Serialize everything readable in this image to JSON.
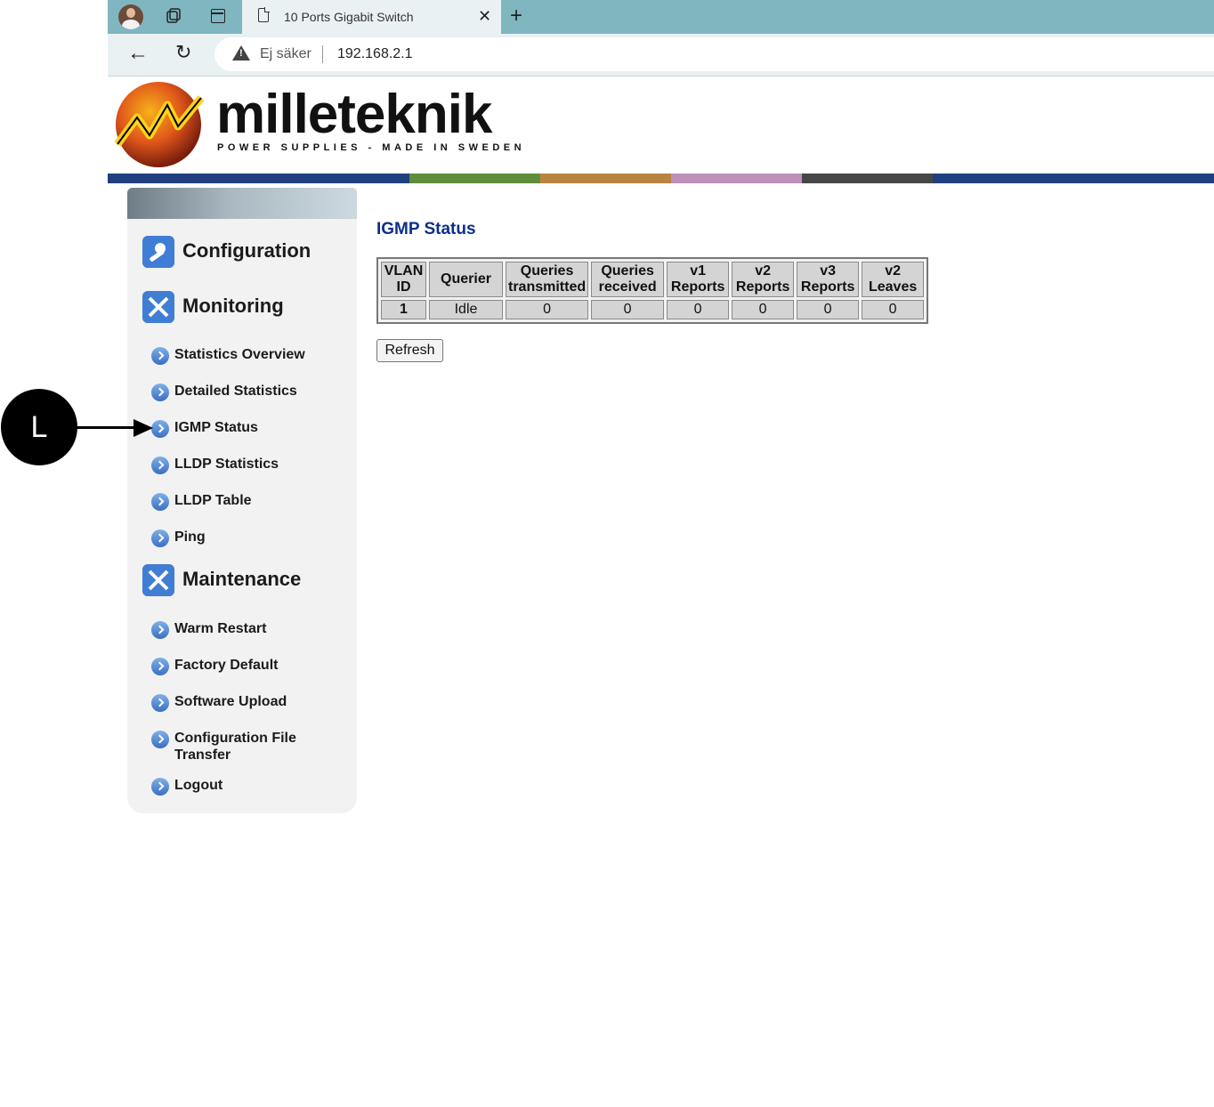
{
  "browser": {
    "tab_title": "10 Ports Gigabit Switch",
    "security_text": "Ej säker",
    "url": "192.168.2.1"
  },
  "brand": {
    "name": "milleteknik",
    "tagline": "POWER SUPPLIES - MADE IN SWEDEN",
    "stripe_colors": [
      "#1f3f7f",
      "#5f8d3c",
      "#b98443",
      "#bf8fb9",
      "#474747",
      "#1f3f7f"
    ]
  },
  "sidebar": {
    "configuration": "Configuration",
    "monitoring": "Monitoring",
    "monitoring_items": [
      "Statistics Overview",
      "Detailed Statistics",
      "IGMP Status",
      "LLDP Statistics",
      "LLDP Table",
      "Ping"
    ],
    "maintenance": "Maintenance",
    "maintenance_items": [
      "Warm Restart",
      "Factory Default",
      "Software Upload",
      "Configuration File Transfer",
      "Logout"
    ]
  },
  "main": {
    "title": "IGMP Status",
    "headers": [
      [
        "VLAN",
        "ID"
      ],
      [
        "Querier"
      ],
      [
        "Queries",
        "transmitted"
      ],
      [
        "Queries",
        "received"
      ],
      [
        "v1",
        "Reports"
      ],
      [
        "v2",
        "Reports"
      ],
      [
        "v3",
        "Reports"
      ],
      [
        "v2",
        "Leaves"
      ]
    ],
    "row": [
      "1",
      "Idle",
      "0",
      "0",
      "0",
      "0",
      "0",
      "0"
    ],
    "refresh": "Refresh"
  },
  "annotation": {
    "label": "L"
  }
}
